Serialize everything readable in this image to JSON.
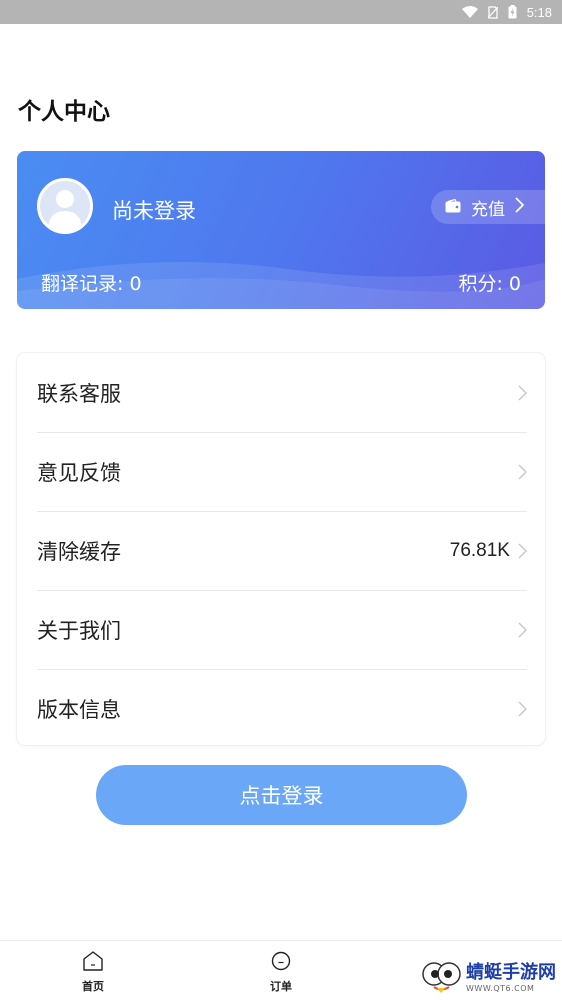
{
  "status_bar": {
    "time": "5:18"
  },
  "page": {
    "title": "个人中心"
  },
  "profile_card": {
    "login_status": "尚未登录",
    "recharge_label": "充值",
    "translation_records": "翻译记录: 0",
    "points": "积分: 0"
  },
  "menu": {
    "items": [
      {
        "label": "联系客服",
        "value": ""
      },
      {
        "label": "意见反馈",
        "value": ""
      },
      {
        "label": "清除缓存",
        "value": "76.81K"
      },
      {
        "label": "关于我们",
        "value": ""
      },
      {
        "label": "版本信息",
        "value": ""
      }
    ]
  },
  "login_button": {
    "label": "点击登录"
  },
  "tabbar": {
    "items": [
      {
        "label": "首页",
        "icon": "home-icon"
      },
      {
        "label": "订单",
        "icon": "order-icon"
      }
    ]
  },
  "watermark": {
    "title": "蜻蜓手游网",
    "url": "WWW.QT6.COM"
  },
  "colors": {
    "card_start": "#4a8df2",
    "card_end": "#5b5ae4",
    "login_button": "#6aa8f7"
  }
}
